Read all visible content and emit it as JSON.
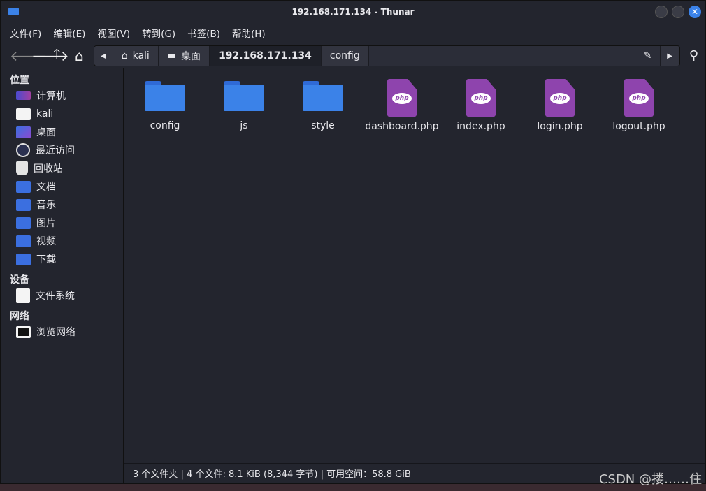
{
  "window": {
    "title": "192.168.171.134 - Thunar"
  },
  "menu": [
    "文件(F)",
    "编辑(E)",
    "视图(V)",
    "转到(G)",
    "书签(B)",
    "帮助(H)"
  ],
  "path": {
    "crumbs": [
      "kali",
      "桌面",
      "192.168.171.134",
      "config"
    ]
  },
  "sidebar": {
    "places_label": "位置",
    "places": [
      "计算机",
      "kali",
      "桌面",
      "最近访问",
      "回收站",
      "文档",
      "音乐",
      "图片",
      "视频",
      "下载"
    ],
    "devices_label": "设备",
    "devices": [
      "文件系统"
    ],
    "network_label": "网络",
    "network": [
      "浏览网络"
    ]
  },
  "files": [
    {
      "name": "config",
      "type": "folder"
    },
    {
      "name": "js",
      "type": "folder"
    },
    {
      "name": "style",
      "type": "folder"
    },
    {
      "name": "dashboard.php",
      "type": "php"
    },
    {
      "name": "index.php",
      "type": "php"
    },
    {
      "name": "login.php",
      "type": "php"
    },
    {
      "name": "logout.php",
      "type": "php"
    }
  ],
  "php_badge": "php",
  "status": "3 个文件夹 | 4 个文件: 8.1 KiB (8,344 字节) | 可用空间：58.8 GiB",
  "watermark": "CSDN @搂……住"
}
